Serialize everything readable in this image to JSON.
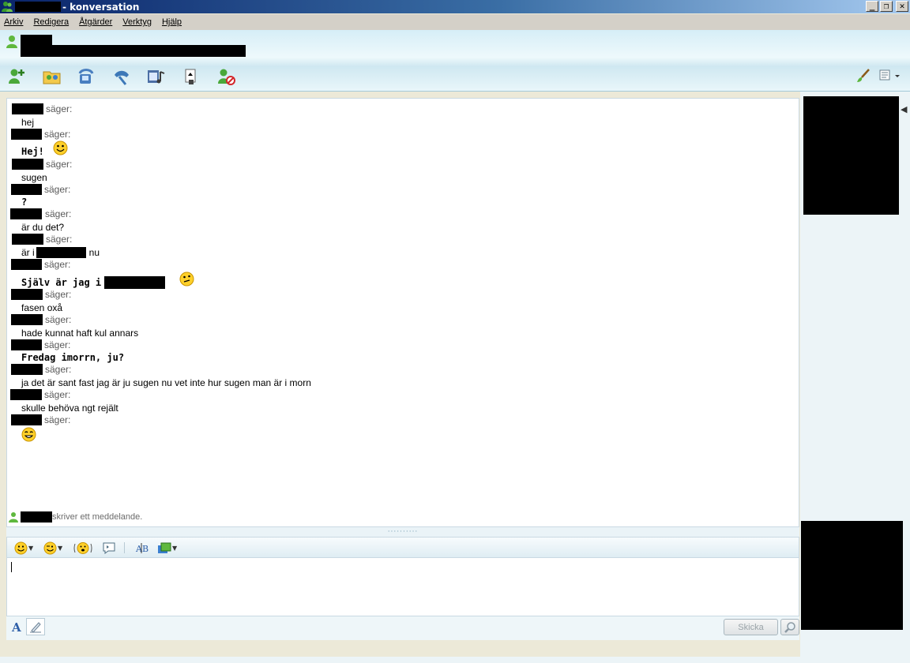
{
  "window": {
    "title_suffix": "- konversation"
  },
  "menu": [
    "Arkiv",
    "Redigera",
    "Åtgärder",
    "Verktyg",
    "Hjälp"
  ],
  "toolbar": {
    "icons": [
      "invite-contact-icon",
      "share-folder-icon",
      "video-call-icon",
      "phone-call-icon",
      "activities-icon",
      "games-icon",
      "block-contact-icon"
    ]
  },
  "messages": [
    {
      "says": "säger:",
      "text": "hej",
      "bold": false
    },
    {
      "says": "säger:",
      "text": "Hej!",
      "bold": true
    },
    {
      "says": "säger:",
      "text": "sugen",
      "bold": false
    },
    {
      "says": "säger:",
      "text": "?",
      "bold": true
    },
    {
      "says": "säger:",
      "text": "är du det?",
      "bold": false
    },
    {
      "says": "säger:",
      "text_before": "är i",
      "text_after": "nu",
      "bold": false
    },
    {
      "says": "säger:",
      "text": "Själv är jag i",
      "bold": true
    },
    {
      "says": "säger:",
      "text": "fasen oxå",
      "bold": false
    },
    {
      "says": "säger:",
      "text": "hade kunnat haft kul annars",
      "bold": false
    },
    {
      "says": "säger:",
      "text": "Fredag imorrn, ju?",
      "bold": true
    },
    {
      "says": "säger:",
      "text": "ja det är sant fast jag är ju sugen nu vet inte hur sugen man är i morn",
      "bold": false
    },
    {
      "says": "säger:",
      "text": "skulle behöva ngt rejält",
      "bold": false
    },
    {
      "says": "säger:",
      "text": "",
      "bold": false
    }
  ],
  "typing_status": "skriver ett meddelande.",
  "compose": {
    "send_label": "Skicka",
    "value": ""
  },
  "colors": {
    "title_start": "#0a246a",
    "header_bg": "#d6eef7",
    "sender_gray": "#5a5a5a"
  }
}
